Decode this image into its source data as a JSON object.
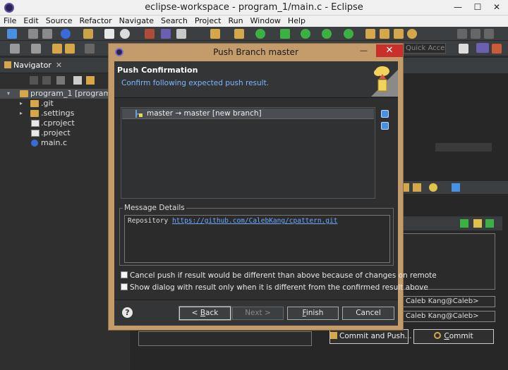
{
  "window": {
    "title": "eclipse-workspace - program_1/main.c - Eclipse",
    "min": "—",
    "max": "☐",
    "close": "✕"
  },
  "menu": [
    "File",
    "Edit",
    "Source",
    "Refactor",
    "Navigate",
    "Search",
    "Project",
    "Run",
    "Window",
    "Help"
  ],
  "toolbar": {
    "quick_access": "Quick Access"
  },
  "navigator": {
    "title": "Navigator",
    "close": "✕",
    "tree": [
      {
        "label": "program_1 [program_1 m",
        "twisty": "▾",
        "icon": "folder-icon",
        "selected": true
      },
      {
        "label": ".git",
        "twisty": "▸",
        "icon": "folder-icon"
      },
      {
        "label": ".settings",
        "twisty": "▸",
        "icon": "folder-icon"
      },
      {
        "label": ".cproject",
        "twisty": "",
        "icon": "xml-file-icon"
      },
      {
        "label": ".project",
        "twisty": "",
        "icon": "xml-file-icon"
      },
      {
        "label": "main.c",
        "twisty": "",
        "icon": "c-file-icon"
      }
    ]
  },
  "dialog": {
    "title": "Push Branch master",
    "header_title": "Push Confirmation",
    "header_subtitle": "Confirm following expected push result.",
    "result_row": "master → master [new branch]",
    "message_group_label": "Message Details",
    "message_repo_label": "Repository",
    "message_repo_url": "https://github.com/CalebKang/cpattern.git",
    "checkbox_cancel": "Cancel push if result would be different than above because of changes on remote",
    "checkbox_show": "Show dialog with result only when it is different from the confirmed result above",
    "help": "?",
    "buttons": {
      "back_prefix": "< ",
      "back_key": "B",
      "back_rest": "ack",
      "next": "Next >",
      "finish_key": "F",
      "finish_rest": "inish",
      "cancel": "Cancel"
    }
  },
  "staging": {
    "author": "Caleb Kang@Caleb>",
    "committer": "Caleb Kang@Caleb>",
    "commit_and_push": "Commit and Push...",
    "commit_key": "C",
    "commit_rest": "ommit"
  }
}
